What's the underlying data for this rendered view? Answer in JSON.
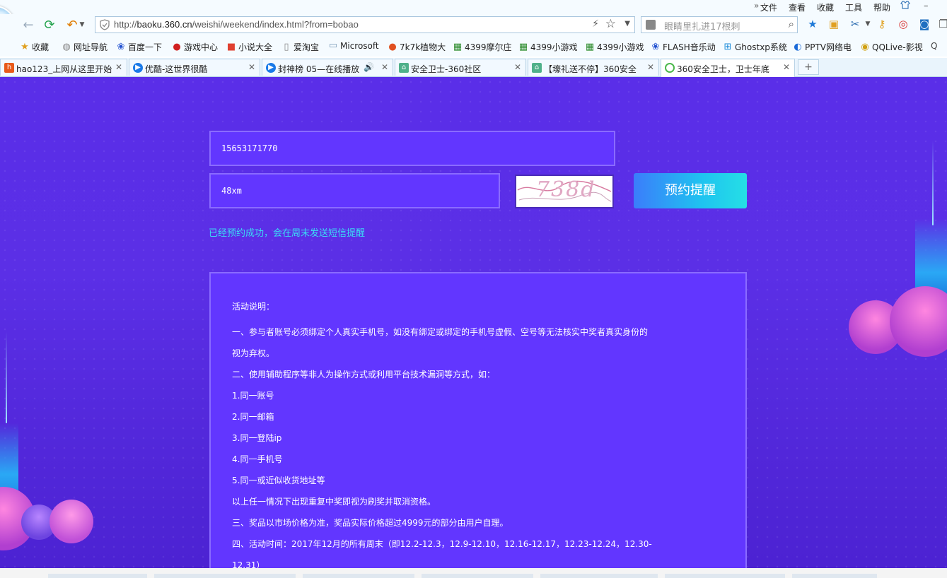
{
  "menu": {
    "more": "»",
    "items": [
      "文件",
      "查看",
      "收藏",
      "工具",
      "帮助"
    ]
  },
  "address_bar": {
    "url_prefix": "http://",
    "url_host": "baoku.360.cn",
    "url_path": "/weishi/weekend/index.html?from=bobao"
  },
  "search": {
    "placeholder": "眼睛里扎进17根刺"
  },
  "bookmarks": [
    {
      "label": "收藏",
      "icon": "star-icon"
    },
    {
      "label": "网址导航",
      "icon": "globe-icon"
    },
    {
      "label": "百度一下",
      "icon": "paw-icon"
    },
    {
      "label": "游戏中心",
      "icon": "game-icon"
    },
    {
      "label": "小说大全",
      "icon": "book-icon"
    },
    {
      "label": "爱淘宝",
      "icon": "page-icon"
    },
    {
      "label": "Microsoft",
      "icon": "folder-icon"
    },
    {
      "label": "7k7k植物大",
      "icon": "balloon-icon"
    },
    {
      "label": "4399摩尔庄",
      "icon": "grid-icon"
    },
    {
      "label": "4399小游戏",
      "icon": "grid-icon"
    },
    {
      "label": "4399小游戏",
      "icon": "grid-icon"
    },
    {
      "label": "FLASH音乐动",
      "icon": "paw-icon"
    },
    {
      "label": "Ghostxp系统",
      "icon": "windows-icon"
    },
    {
      "label": "PPTV网络电",
      "icon": "pptv-icon"
    },
    {
      "label": "QQLive-影视",
      "icon": "qqlive-icon"
    }
  ],
  "tabs": [
    {
      "title": "hao123_上网从这里开始",
      "icon": "hao-icon"
    },
    {
      "title": "优酷-这世界很酷",
      "icon": "youku-icon"
    },
    {
      "title": "封神榜 05—在线播放",
      "icon": "youku-icon"
    },
    {
      "title": "安全卫士-360社区",
      "icon": "house-icon"
    },
    {
      "title": "【壕礼送不停】360安全",
      "icon": "house-icon"
    },
    {
      "title": "360安全卫士，卫士年底",
      "icon": "loading-icon"
    }
  ],
  "form": {
    "phone": "15653171770",
    "captcha_input": "48xm",
    "captcha_text": "738d",
    "submit_label": "预约提醒",
    "success_msg": "已经预约成功，会在周末发送短信提醒"
  },
  "rules": {
    "title": "活动说明：",
    "lines": [
      "一、参与者账号必须绑定个人真实手机号，如没有绑定或绑定的手机号虚假、空号等无法核实中奖者真实身份的",
      "视为弃权。",
      "二、使用辅助程序等非人为操作方式或利用平台技术漏洞等方式，如：",
      "1.同一账号",
      "2.同一邮箱",
      "3.同一登陆ip",
      "4.同一手机号",
      "5.同一或近似收货地址等",
      "以上任一情况下出现重复中奖即视为刷奖并取消资格。",
      "三、奖品以市场价格为准，奖品实际价格超过4999元的部分由用户自理。",
      "四、活动时间：2017年12月的所有周末（即12.2-12.3，12.9-12.10，12.16-12.17，12.23-12.24，12.30-",
      "12.31）"
    ]
  },
  "colors": {
    "page_bg": "#5a2ee8",
    "field_bg": "#6236ff",
    "success_text": "#3bdcf4",
    "button_gradient_start": "#3b7dfb",
    "button_gradient_end": "#25dfe5"
  }
}
